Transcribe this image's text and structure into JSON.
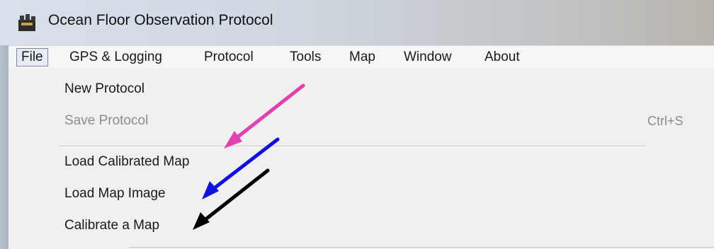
{
  "window": {
    "title": "Ocean Floor Observation Protocol",
    "icon": "app-icon"
  },
  "menubar": {
    "items": [
      {
        "label": "File",
        "active": true
      },
      {
        "label": "GPS & Logging"
      },
      {
        "label": "Protocol"
      },
      {
        "label": "Tools"
      },
      {
        "label": "Map"
      },
      {
        "label": "Window"
      },
      {
        "label": "About"
      }
    ]
  },
  "file_menu": {
    "items": [
      {
        "label": "New Protocol",
        "enabled": true
      },
      {
        "label": "Save Protocol",
        "enabled": false,
        "shortcut": "Ctrl+S"
      },
      {
        "label": "Load Calibrated Map",
        "enabled": true
      },
      {
        "label": "Load Map Image",
        "enabled": true
      },
      {
        "label": "Calibrate a Map",
        "enabled": true
      }
    ]
  },
  "annotations": {
    "arrows": [
      {
        "color": "#e040b0",
        "points_to": "Load Calibrated Map"
      },
      {
        "color": "#1010e0",
        "points_to": "Load Map Image"
      },
      {
        "color": "#000000",
        "points_to": "Calibrate a Map"
      }
    ]
  }
}
